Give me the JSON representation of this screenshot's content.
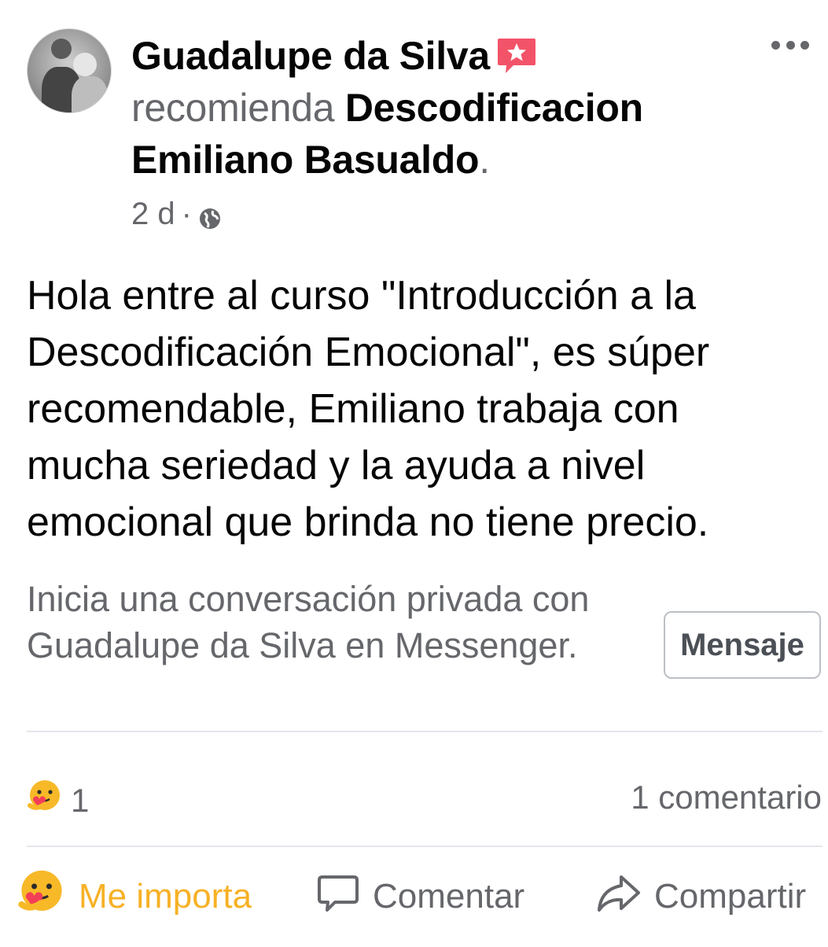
{
  "post": {
    "author": "Guadalupe da Silva",
    "verb": "recomienda",
    "page_name": "Descodificacion Emiliano Basualdo",
    "page_suffix": ".",
    "time": "2 d",
    "separator": "·",
    "audience_icon": "globe-icon",
    "badge_icon": "recommendation-badge-icon",
    "body": "Hola entre al curso \"Introducción a la Descodificación Emocional\", es súper recomendable, Emiliano trabaja con mucha seriedad y la ayuda a nivel emocional que brinda no tiene precio."
  },
  "messenger": {
    "prompt": "Inicia una conversación privada con Guadalupe da Silva en Messenger.",
    "button_label": "Mensaje"
  },
  "stats": {
    "reaction_icon": "care-reaction-icon",
    "reaction_count": "1",
    "comments": "1 comentario"
  },
  "actions": {
    "like_label": "Me importa",
    "comment_label": "Comentar",
    "share_label": "Compartir"
  },
  "colors": {
    "primary_text": "#050505",
    "secondary_text": "#65676b",
    "care_yellow": "#f7b125",
    "badge_pink": "#f35369",
    "divider": "#e4e6eb"
  }
}
